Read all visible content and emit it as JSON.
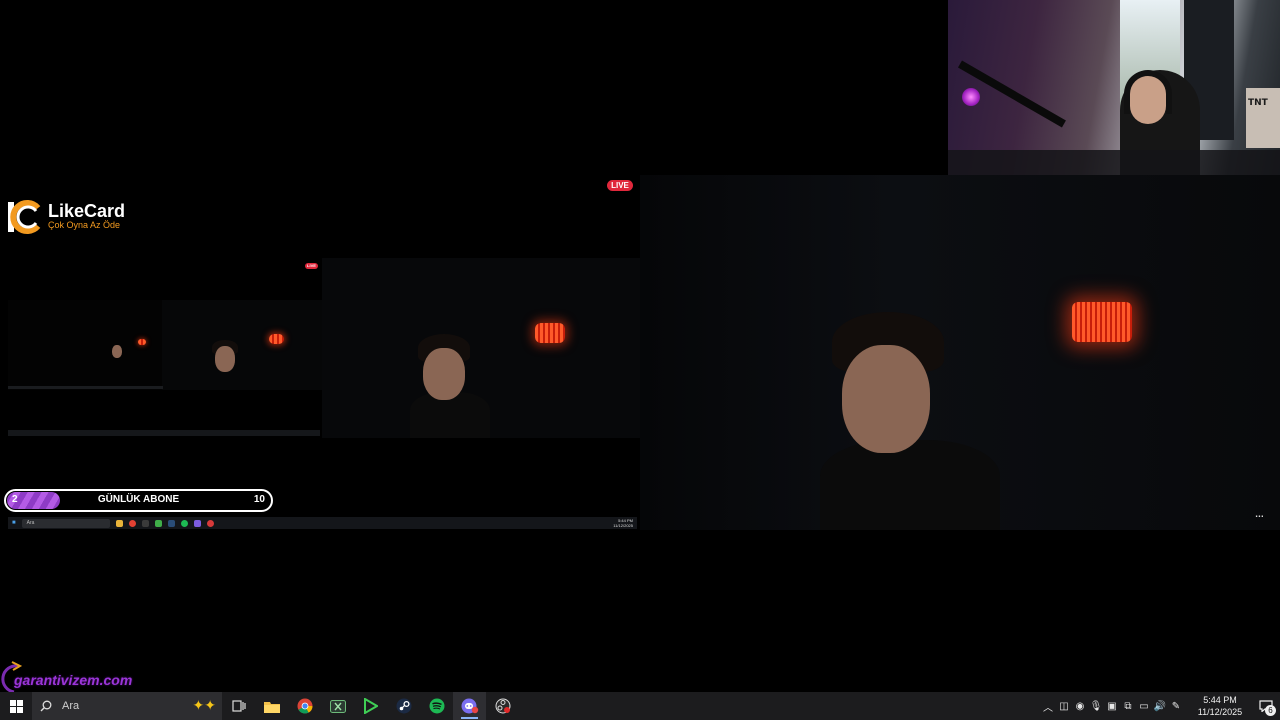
{
  "overlays": {
    "live_badge": "LIVE",
    "likecard": {
      "name": "LikeCard",
      "slogan": "Çok Oyna  Az Öde"
    },
    "goal": {
      "title": "GÜNLÜK ABONE",
      "current": "2",
      "target": "10",
      "progress": 0.2,
      "fill_color": "#8e3bc6"
    },
    "garantivizem": "garantivizem.com",
    "webcam_box_label": "TNT",
    "more_button": "..."
  },
  "nested_stream": {
    "taskbar_search": "Ara",
    "clock_time": "5:44 PM",
    "clock_date": "11/12/2025"
  },
  "taskbar": {
    "search_placeholder": "Ara",
    "apps": [
      {
        "name": "task-view-icon",
        "active": false
      },
      {
        "name": "file-explorer-icon",
        "active": false
      },
      {
        "name": "chrome-icon",
        "active": false
      },
      {
        "name": "xbox-app-icon",
        "active": false
      },
      {
        "name": "play-launcher-icon",
        "active": false
      },
      {
        "name": "steam-icon",
        "active": false
      },
      {
        "name": "spotify-icon",
        "active": false
      },
      {
        "name": "discord-icon",
        "active": true
      },
      {
        "name": "obs-record-icon",
        "active": false
      }
    ],
    "clock": {
      "time": "5:44 PM",
      "date": "11/12/2025"
    },
    "notification_count": "6"
  }
}
